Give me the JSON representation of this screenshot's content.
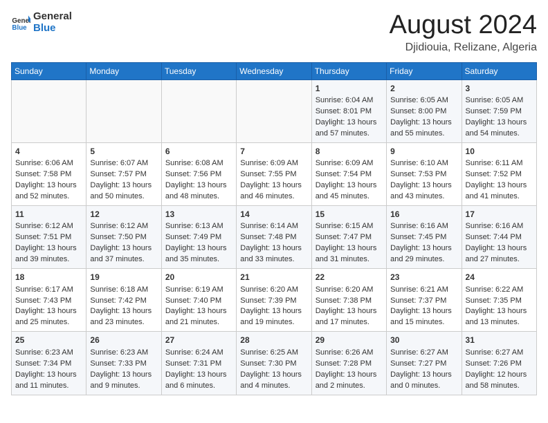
{
  "header": {
    "logo_line1": "General",
    "logo_line2": "Blue",
    "main_title": "August 2024",
    "subtitle": "Djidiouia, Relizane, Algeria"
  },
  "calendar": {
    "days_of_week": [
      "Sunday",
      "Monday",
      "Tuesday",
      "Wednesday",
      "Thursday",
      "Friday",
      "Saturday"
    ],
    "weeks": [
      [
        {
          "day": "",
          "text": ""
        },
        {
          "day": "",
          "text": ""
        },
        {
          "day": "",
          "text": ""
        },
        {
          "day": "",
          "text": ""
        },
        {
          "day": "1",
          "text": "Sunrise: 6:04 AM\nSunset: 8:01 PM\nDaylight: 13 hours and 57 minutes."
        },
        {
          "day": "2",
          "text": "Sunrise: 6:05 AM\nSunset: 8:00 PM\nDaylight: 13 hours and 55 minutes."
        },
        {
          "day": "3",
          "text": "Sunrise: 6:05 AM\nSunset: 7:59 PM\nDaylight: 13 hours and 54 minutes."
        }
      ],
      [
        {
          "day": "4",
          "text": "Sunrise: 6:06 AM\nSunset: 7:58 PM\nDaylight: 13 hours and 52 minutes."
        },
        {
          "day": "5",
          "text": "Sunrise: 6:07 AM\nSunset: 7:57 PM\nDaylight: 13 hours and 50 minutes."
        },
        {
          "day": "6",
          "text": "Sunrise: 6:08 AM\nSunset: 7:56 PM\nDaylight: 13 hours and 48 minutes."
        },
        {
          "day": "7",
          "text": "Sunrise: 6:09 AM\nSunset: 7:55 PM\nDaylight: 13 hours and 46 minutes."
        },
        {
          "day": "8",
          "text": "Sunrise: 6:09 AM\nSunset: 7:54 PM\nDaylight: 13 hours and 45 minutes."
        },
        {
          "day": "9",
          "text": "Sunrise: 6:10 AM\nSunset: 7:53 PM\nDaylight: 13 hours and 43 minutes."
        },
        {
          "day": "10",
          "text": "Sunrise: 6:11 AM\nSunset: 7:52 PM\nDaylight: 13 hours and 41 minutes."
        }
      ],
      [
        {
          "day": "11",
          "text": "Sunrise: 6:12 AM\nSunset: 7:51 PM\nDaylight: 13 hours and 39 minutes."
        },
        {
          "day": "12",
          "text": "Sunrise: 6:12 AM\nSunset: 7:50 PM\nDaylight: 13 hours and 37 minutes."
        },
        {
          "day": "13",
          "text": "Sunrise: 6:13 AM\nSunset: 7:49 PM\nDaylight: 13 hours and 35 minutes."
        },
        {
          "day": "14",
          "text": "Sunrise: 6:14 AM\nSunset: 7:48 PM\nDaylight: 13 hours and 33 minutes."
        },
        {
          "day": "15",
          "text": "Sunrise: 6:15 AM\nSunset: 7:47 PM\nDaylight: 13 hours and 31 minutes."
        },
        {
          "day": "16",
          "text": "Sunrise: 6:16 AM\nSunset: 7:45 PM\nDaylight: 13 hours and 29 minutes."
        },
        {
          "day": "17",
          "text": "Sunrise: 6:16 AM\nSunset: 7:44 PM\nDaylight: 13 hours and 27 minutes."
        }
      ],
      [
        {
          "day": "18",
          "text": "Sunrise: 6:17 AM\nSunset: 7:43 PM\nDaylight: 13 hours and 25 minutes."
        },
        {
          "day": "19",
          "text": "Sunrise: 6:18 AM\nSunset: 7:42 PM\nDaylight: 13 hours and 23 minutes."
        },
        {
          "day": "20",
          "text": "Sunrise: 6:19 AM\nSunset: 7:40 PM\nDaylight: 13 hours and 21 minutes."
        },
        {
          "day": "21",
          "text": "Sunrise: 6:20 AM\nSunset: 7:39 PM\nDaylight: 13 hours and 19 minutes."
        },
        {
          "day": "22",
          "text": "Sunrise: 6:20 AM\nSunset: 7:38 PM\nDaylight: 13 hours and 17 minutes."
        },
        {
          "day": "23",
          "text": "Sunrise: 6:21 AM\nSunset: 7:37 PM\nDaylight: 13 hours and 15 minutes."
        },
        {
          "day": "24",
          "text": "Sunrise: 6:22 AM\nSunset: 7:35 PM\nDaylight: 13 hours and 13 minutes."
        }
      ],
      [
        {
          "day": "25",
          "text": "Sunrise: 6:23 AM\nSunset: 7:34 PM\nDaylight: 13 hours and 11 minutes."
        },
        {
          "day": "26",
          "text": "Sunrise: 6:23 AM\nSunset: 7:33 PM\nDaylight: 13 hours and 9 minutes."
        },
        {
          "day": "27",
          "text": "Sunrise: 6:24 AM\nSunset: 7:31 PM\nDaylight: 13 hours and 6 minutes."
        },
        {
          "day": "28",
          "text": "Sunrise: 6:25 AM\nSunset: 7:30 PM\nDaylight: 13 hours and 4 minutes."
        },
        {
          "day": "29",
          "text": "Sunrise: 6:26 AM\nSunset: 7:28 PM\nDaylight: 13 hours and 2 minutes."
        },
        {
          "day": "30",
          "text": "Sunrise: 6:27 AM\nSunset: 7:27 PM\nDaylight: 13 hours and 0 minutes."
        },
        {
          "day": "31",
          "text": "Sunrise: 6:27 AM\nSunset: 7:26 PM\nDaylight: 12 hours and 58 minutes."
        }
      ]
    ]
  }
}
